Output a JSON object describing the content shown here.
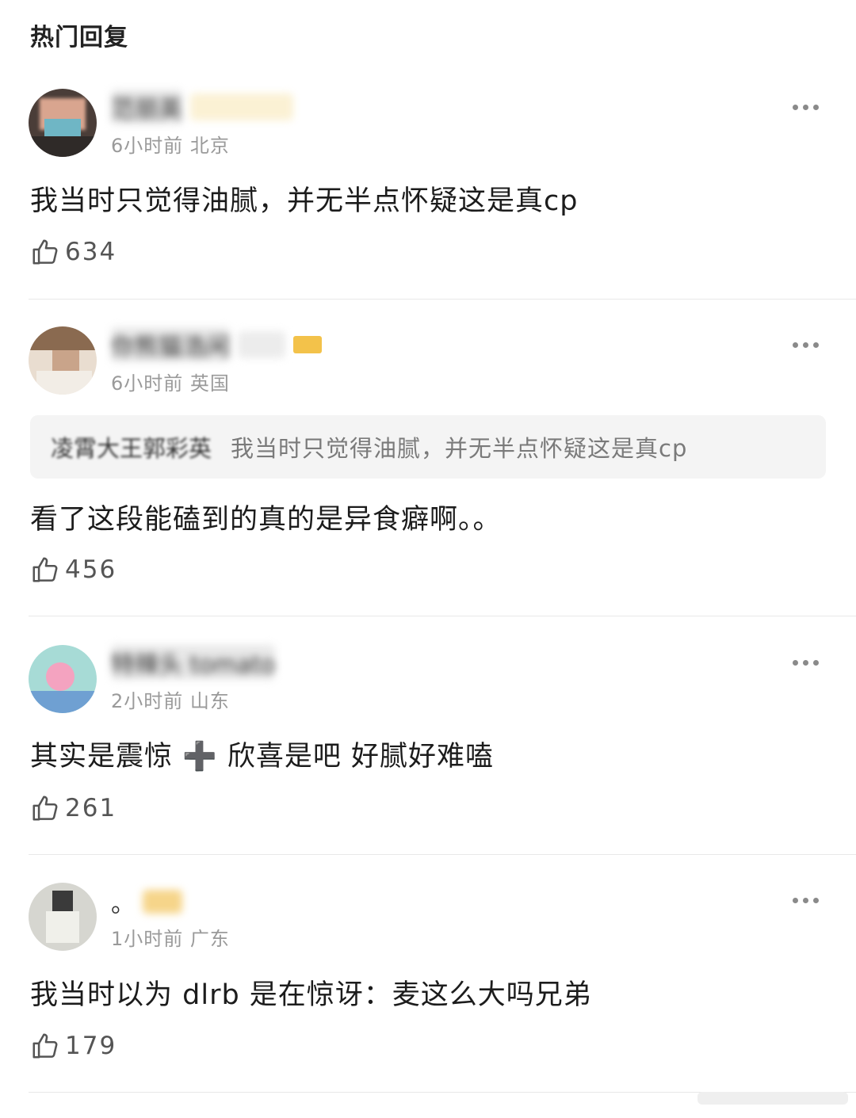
{
  "section_title": "热门回复",
  "comments": [
    {
      "username": "范丽英",
      "time": "6小时前",
      "location": "北京",
      "text": "我当时只觉得油腻，并无半点怀疑这是真cp",
      "likes": "634",
      "avatar_color": "#8aa9b8"
    },
    {
      "username": "你熊猫浩闲",
      "time": "6小时前",
      "location": "英国",
      "quote_author": "凌霄大王郭彩英",
      "quote_text": "我当时只觉得油腻，并无半点怀疑这是真cp",
      "text": "看了这段能磕到的真的是异食癖啊。。",
      "likes": "456",
      "avatar_color": "#c9a98a"
    },
    {
      "username": "特辣头 tomato",
      "time": "2小时前",
      "location": "山东",
      "text_before": "其实是震惊",
      "text_plus": "➕",
      "text_after": "欣喜是吧 好腻好难嗑",
      "likes": "261",
      "avatar_color": "#9fd3cf"
    },
    {
      "username": "。",
      "time": "1小时前",
      "location": "广东",
      "text": "我当时以为 dlrb 是在惊讶：麦这么大吗兄弟",
      "likes": "179",
      "avatar_color": "#b9b9b0"
    }
  ],
  "icons": {
    "like": "thumbs-up-icon",
    "more": "more-dots-icon"
  },
  "colors": {
    "meta": "#9a9a9a",
    "badge": "#f3c24a"
  }
}
